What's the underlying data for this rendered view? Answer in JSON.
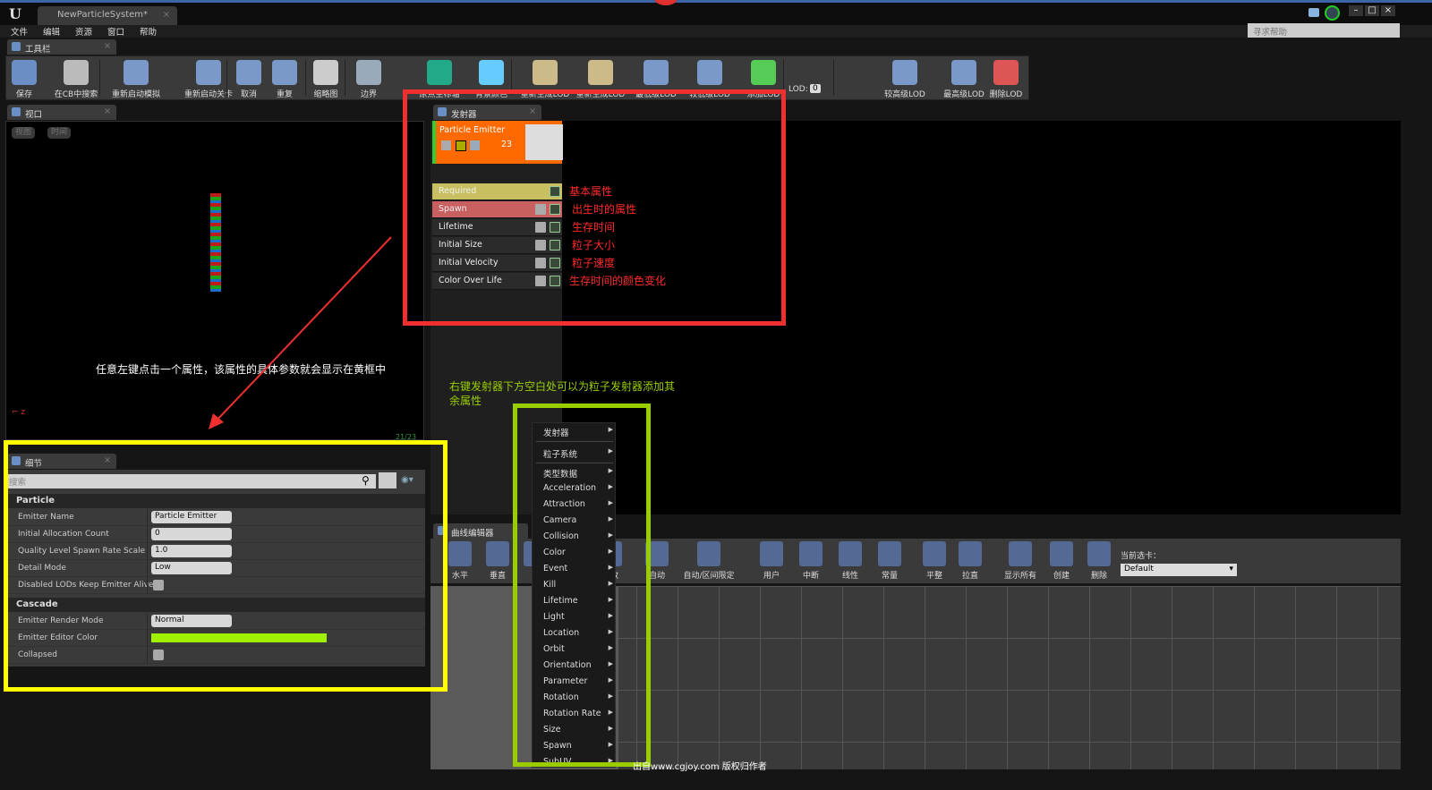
{
  "window": {
    "doc_tab": "NewParticleSystem*",
    "help_placeholder": "寻求帮助"
  },
  "menu": [
    "文件",
    "编辑",
    "资源",
    "窗口",
    "帮助"
  ],
  "toolbar": {
    "tab": "工具栏",
    "buttons": [
      "保存",
      "在CB中搜索",
      "重新启动模拟",
      "重新启动关卡",
      "取消",
      "重复",
      "缩略图",
      "边界",
      "原点坐标轴",
      "背景颜色",
      "重新生成LOD",
      "重新生成LOD",
      "最低级LOD",
      "较低级LOD",
      "添加LOD",
      "添加LOD",
      "较高级LOD",
      "最高级LOD",
      "删除LOD"
    ],
    "lod_label": "LOD:",
    "lod_value": "0"
  },
  "viewport": {
    "tab": "视口",
    "buttons": [
      "视图",
      "时间"
    ],
    "annotation": "任意左键点击一个属性，该属性的具体参数就会显示在黄框中",
    "stats": "21/23"
  },
  "details": {
    "tab": "细节",
    "search_placeholder": "搜索",
    "particle": {
      "title": "Particle",
      "rows": [
        {
          "label": "Emitter Name",
          "value": "Particle Emitter"
        },
        {
          "label": "Initial Allocation Count",
          "value": "0"
        },
        {
          "label": "Quality Level Spawn Rate Scale",
          "value": "1.0"
        },
        {
          "label": "Detail Mode",
          "value": "Low"
        },
        {
          "label": "Disabled LODs Keep Emitter Alive",
          "value": ""
        }
      ]
    },
    "cascade": {
      "title": "Cascade",
      "rows": [
        {
          "label": "Emitter Render Mode",
          "value": "Normal"
        },
        {
          "label": "Emitter Editor Color",
          "value": ""
        },
        {
          "label": "Collapsed",
          "value": ""
        }
      ]
    },
    "emitter_color": "#a0f000"
  },
  "emitters": {
    "tab": "发射器",
    "emitter_name": "Particle Emitter",
    "count": "23",
    "modules": [
      {
        "name": "Required",
        "note": "基本属性",
        "color": "#c8c060"
      },
      {
        "name": "Spawn",
        "note": "出生时的属性",
        "color": "#c86060"
      },
      {
        "name": "Lifetime",
        "note": "生存时间"
      },
      {
        "name": "Initial Size",
        "note": "粒子大小"
      },
      {
        "name": "Initial Velocity",
        "note": "粒子速度"
      },
      {
        "name": "Color Over Life",
        "note": "生存时间的颜色变化"
      }
    ],
    "annotation": "右键发射器下方空白处可以为粒子发射器添加其余属性"
  },
  "curve_editor": {
    "tab": "曲线编辑器",
    "buttons": [
      "水平",
      "垂直",
      "适",
      "",
      "缩放",
      "自动",
      "自动/区间限定",
      "用户",
      "中断",
      "线性",
      "常量",
      "平整",
      "拉直",
      "显示所有",
      "创建",
      "删除"
    ],
    "current_tab_label": "当前选卡：",
    "current_tab_value": "Default"
  },
  "context_menu": [
    "发射器",
    "粒子系统",
    "类型数据",
    "Acceleration",
    "Attraction",
    "Camera",
    "Collision",
    "Color",
    "Event",
    "Kill",
    "Lifetime",
    "Light",
    "Location",
    "Orbit",
    "Orientation",
    "Parameter",
    "Rotation",
    "Rotation Rate",
    "Size",
    "Spawn",
    "SubUV"
  ],
  "watermark": "出自www.cgjoy.com 版权归作者",
  "colors": {
    "red_box": "#f03030",
    "yellow_box": "#ffff00",
    "green_box": "#9acd00",
    "emitter_header": "#ff6a00"
  }
}
